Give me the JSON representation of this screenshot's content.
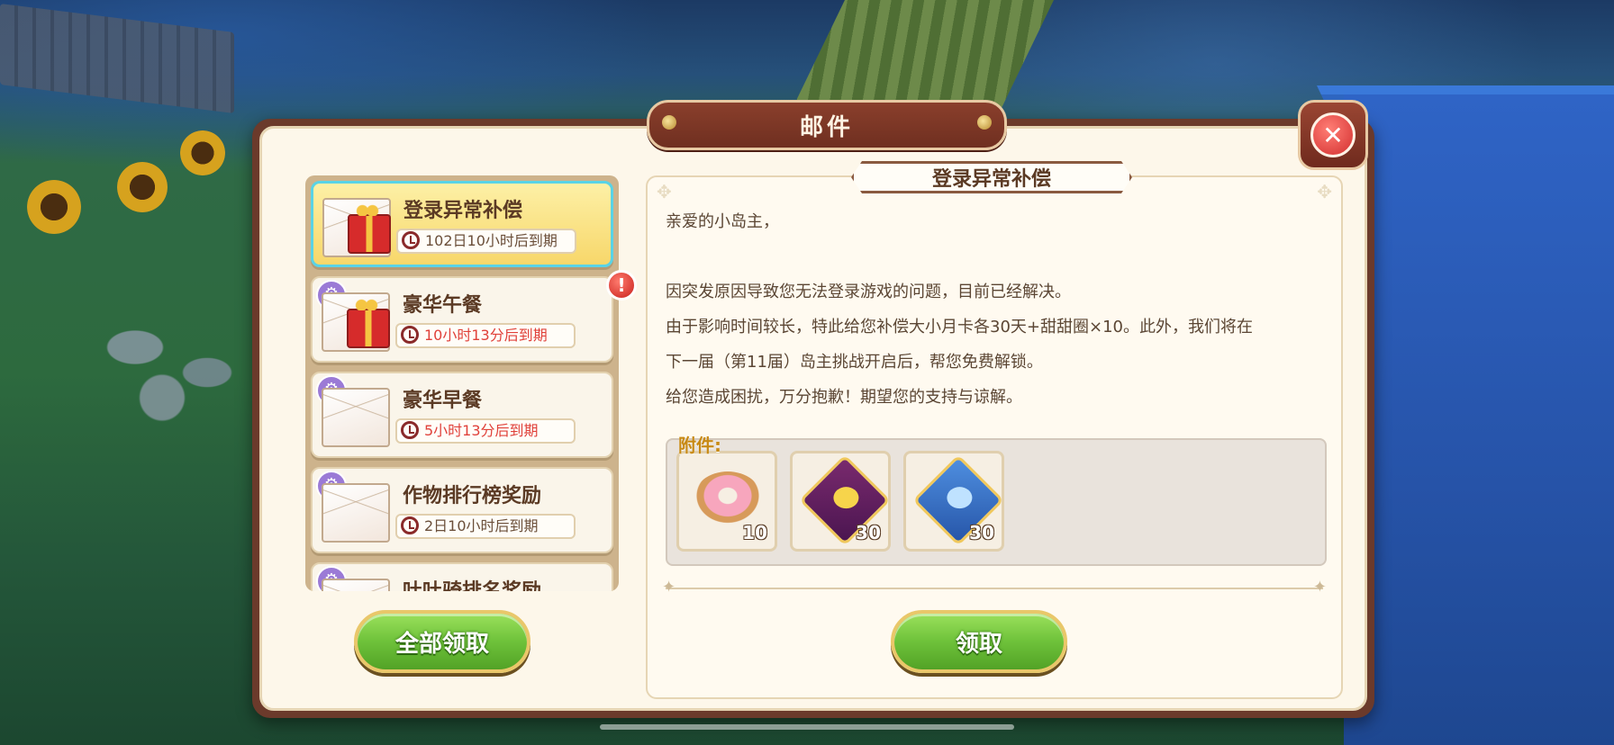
{
  "dialog": {
    "title": "邮件",
    "close_icon": "close-icon",
    "buttons": {
      "claim_all": "全部领取",
      "claim": "领取"
    }
  },
  "mails": [
    {
      "title": "登录异常补偿",
      "expiry": "102日10小时后到期",
      "icon": "gift-envelope-icon",
      "selected": true,
      "urgent": false
    },
    {
      "title": "豪华午餐",
      "expiry": "10小时13分后到期",
      "icon": "gift-envelope-icon",
      "selected": false,
      "urgent": true,
      "alert": "!"
    },
    {
      "title": "豪华早餐",
      "expiry": "5小时13分后到期",
      "icon": "envelope-icon",
      "selected": false,
      "urgent": true
    },
    {
      "title": "作物排行榜奖励",
      "expiry": "2日10小时后到期",
      "icon": "envelope-icon",
      "selected": false,
      "urgent": false
    },
    {
      "title": "吐吐骑排名奖励",
      "expiry": "",
      "icon": "envelope-icon",
      "selected": false,
      "urgent": false
    }
  ],
  "detail": {
    "title": "登录异常补偿",
    "greeting": "亲爱的小岛主，",
    "paragraphs": [
      "因突发原因导致您无法登录游戏的问题，目前已经解决。",
      "由于影响时间较长，特此给您补偿大小月卡各30天+甜甜圈×10。此外，我们将在",
      "下一届（第11届）岛主挑战开启后，帮您免费解锁。",
      "给您造成困扰，万分抱歉！期望您的支持与谅解。"
    ],
    "attachments_label": "附件:",
    "attachments": [
      {
        "name": "donut-item",
        "qty": "10"
      },
      {
        "name": "purple-card-item",
        "qty": "30"
      },
      {
        "name": "blue-card-item",
        "qty": "30"
      }
    ]
  },
  "colors": {
    "frame": "#6b3a2b",
    "selected_item": "#f7d76a",
    "urgent_text": "#e0413a",
    "button_green": "#6ec23a"
  }
}
